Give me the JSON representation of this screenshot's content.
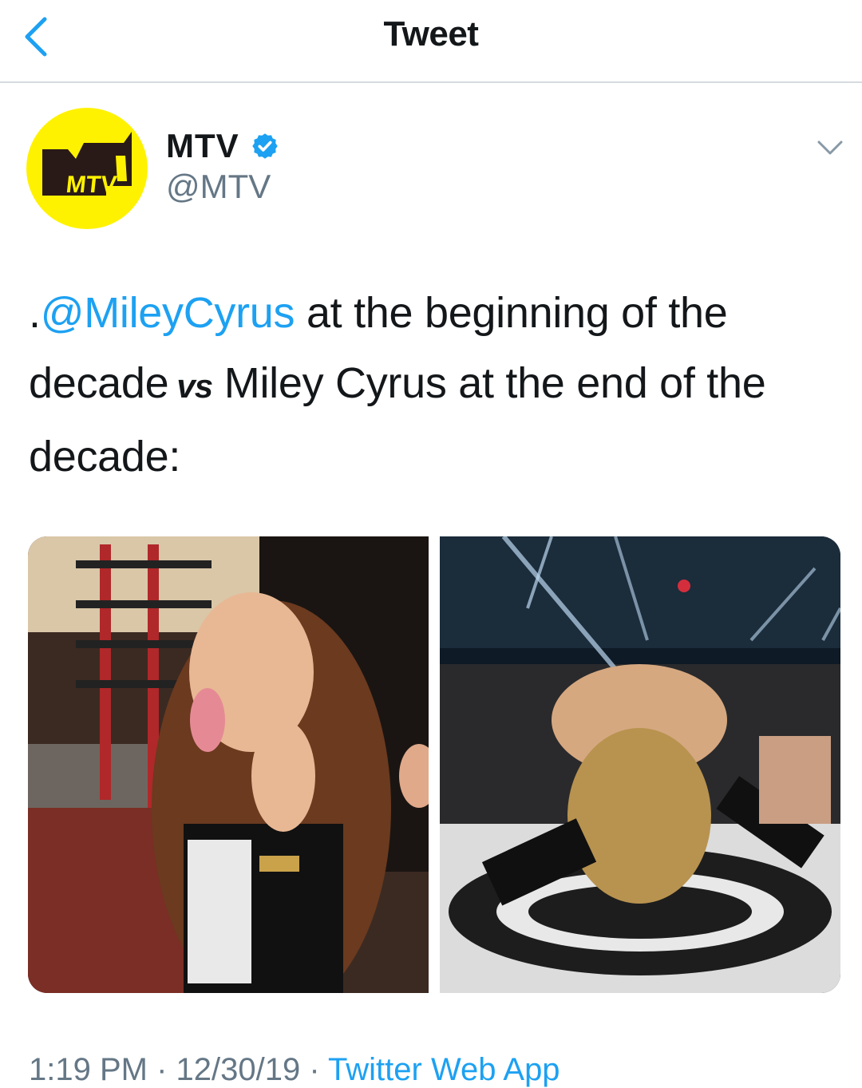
{
  "header": {
    "title": "Tweet"
  },
  "author": {
    "name": "MTV",
    "handle": "@MTV"
  },
  "tweet": {
    "mention": "@MileyCyrus",
    "line_prefix": ".",
    "text_part1": " at the beginning of the decade",
    "vs": "vs",
    "text_part2": " Miley Cyrus at the end of the decade:"
  },
  "meta": {
    "time": "1:19 PM · 12/30/19 · ",
    "source": "Twitter Web App"
  },
  "colors": {
    "accent": "#1da1f2",
    "avatar_bg": "#fff200",
    "secondary_text": "#657786"
  }
}
